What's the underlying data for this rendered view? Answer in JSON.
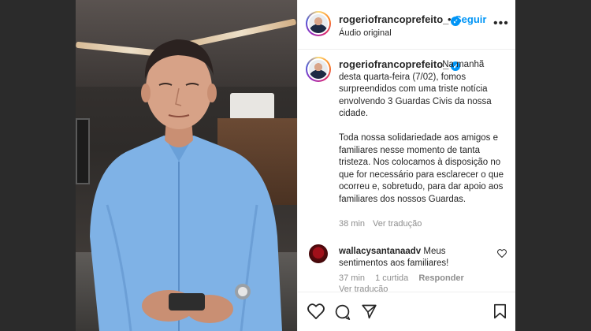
{
  "post": {
    "username": "rogeriofrancoprefeito_",
    "follow_label": "Seguir",
    "audio_label": "Áudio original",
    "more_label": "•••",
    "caption_text": "Na manhã desta quarta-feira (7/02), fomos surpreendidos com uma triste notícia envolvendo 3 Guardas Civis da nossa cidade.\n\nToda nossa solidariedade aos amigos e familiares nesse momento de tanta tristeza. Nos colocamos à disposição no que for necessário para esclarecer o que ocorreu e, sobretudo, para dar apoio aos familiares dos nossos Guardas.",
    "caption_time": "38 min",
    "caption_translate": "Ver tradução"
  },
  "comments": [
    {
      "username": "wallacysantanaadv",
      "text": "Meus sentimentos aos familiares!",
      "time": "37 min",
      "likes": "1 curtida",
      "reply": "Responder",
      "translate": "Ver tradução"
    }
  ],
  "icons": {
    "verified": "verified-badge-icon",
    "like": "heart-icon",
    "comment": "comment-icon",
    "share": "share-icon",
    "save": "bookmark-icon"
  },
  "colors": {
    "accent": "#0095f6",
    "text": "#262626",
    "muted": "#8e8e8e"
  }
}
